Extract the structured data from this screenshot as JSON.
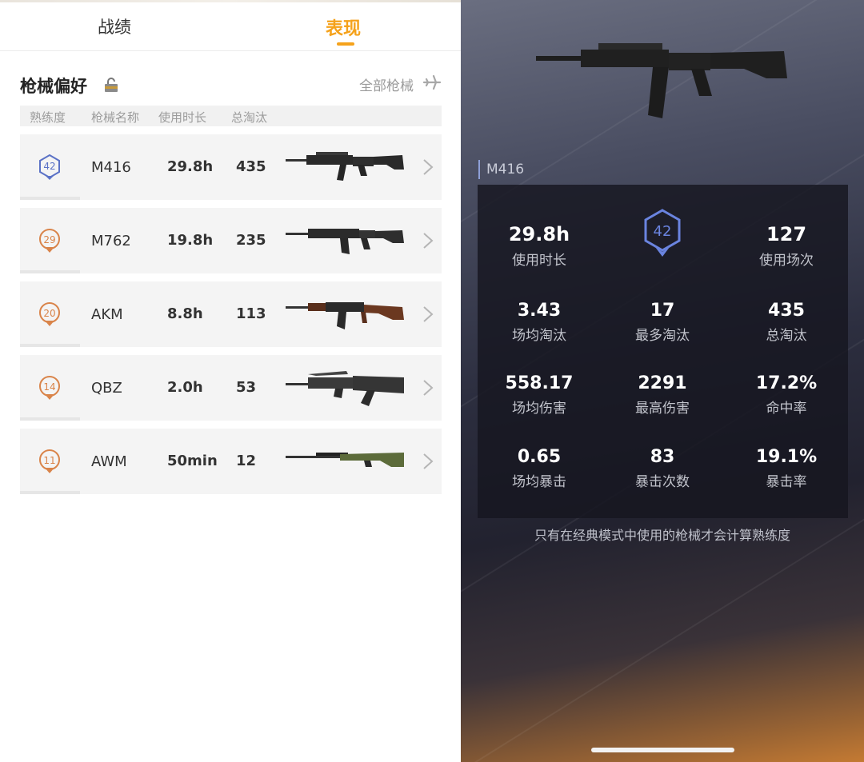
{
  "tabs": [
    {
      "label": "战绩",
      "active": false
    },
    {
      "label": "表现",
      "active": true
    }
  ],
  "accent_color": "#f5a21b",
  "section": {
    "title": "枪械偏好",
    "lock_icon": "lock-icon",
    "all_link": "全部枪械",
    "all_icon": "plane-icon"
  },
  "columns": [
    "熟练度",
    "枪械名称",
    "使用时长",
    "总淘汰"
  ],
  "weapons": [
    {
      "level": "42",
      "name": "M416",
      "hours": "29.8h",
      "kills": "435",
      "badge_color": "#5b72c6"
    },
    {
      "level": "29",
      "name": "M762",
      "hours": "19.8h",
      "kills": "235",
      "badge_color": "#d9844a"
    },
    {
      "level": "20",
      "name": "AKM",
      "hours": "8.8h",
      "kills": "113",
      "badge_color": "#d9844a"
    },
    {
      "level": "14",
      "name": "QBZ",
      "hours": "2.0h",
      "kills": "53",
      "badge_color": "#d9844a"
    },
    {
      "level": "11",
      "name": "AWM",
      "hours": "50min",
      "kills": "12",
      "badge_color": "#d9844a"
    }
  ],
  "detail": {
    "gun_name": "M416",
    "level": "42",
    "stats": [
      {
        "value": "29.8h",
        "label": "使用时长"
      },
      {
        "value": "127",
        "label": "使用场次"
      },
      {
        "value": "3.43",
        "label": "场均淘汰"
      },
      {
        "value": "17",
        "label": "最多淘汰"
      },
      {
        "value": "435",
        "label": "总淘汰"
      },
      {
        "value": "558.17",
        "label": "场均伤害"
      },
      {
        "value": "2291",
        "label": "最高伤害"
      },
      {
        "value": "17.2%",
        "label": "命中率"
      },
      {
        "value": "0.65",
        "label": "场均暴击"
      },
      {
        "value": "83",
        "label": "暴击次数"
      },
      {
        "value": "19.1%",
        "label": "暴击率"
      }
    ],
    "note": "只有在经典模式中使用的枪械才会计算熟练度"
  }
}
